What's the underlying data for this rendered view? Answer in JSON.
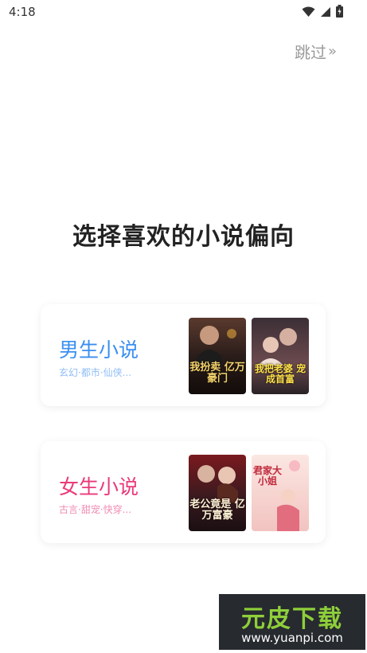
{
  "status_bar": {
    "time": "4:18"
  },
  "skip": {
    "label": "跳过",
    "chevron": "»"
  },
  "title": "选择喜欢的小说偏向",
  "cards": {
    "male": {
      "title": "男生小说",
      "subtitle": "玄幻·都市·仙侠...",
      "cover1_text": "我扮卖 亿万豪门",
      "cover2_text": "我把老婆 宠成首富"
    },
    "female": {
      "title": "女生小说",
      "subtitle": "古言·甜宠·快穿...",
      "cover1_text": "老公竟是 亿万富豪",
      "cover2_text": "君家大小姐"
    }
  },
  "watermark": {
    "brand": "元皮下载",
    "url": "www.yuanpi.com"
  },
  "colors": {
    "male_accent": "#3b8ff0",
    "female_accent": "#ea3a79",
    "watermark_green": "#8ecf3a"
  }
}
